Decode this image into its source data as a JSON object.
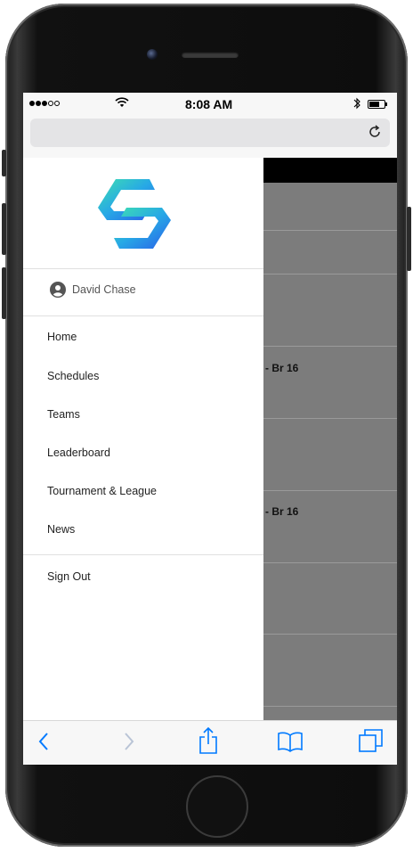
{
  "status_bar": {
    "time": "8:08 AM",
    "signal_bars": 3,
    "battery_level": 0.7
  },
  "url_bar": {
    "value": "",
    "reload_icon": "reload-icon"
  },
  "drawer": {
    "logo_icon": "hexagon-s-logo-icon",
    "user": {
      "icon": "user-circle-icon",
      "name": "David Chase"
    },
    "menu": [
      {
        "label": "Home"
      },
      {
        "label": "Schedules"
      },
      {
        "label": "Teams"
      },
      {
        "label": "Leaderboard"
      },
      {
        "label": "Tournament & League"
      },
      {
        "label": "News"
      }
    ],
    "sign_out": "Sign Out"
  },
  "background_page": {
    "rows": [
      {
        "text": ""
      },
      {
        "text": ""
      },
      {
        "text": "- Br 16"
      },
      {
        "text": ""
      },
      {
        "text": "- Br 16"
      },
      {
        "text": ""
      },
      {
        "text": ""
      }
    ]
  },
  "toolbar": {
    "icons": [
      "back-icon",
      "forward-icon",
      "share-icon",
      "bookmarks-icon",
      "tabs-icon"
    ]
  },
  "colors": {
    "accent": "#007aff",
    "logo_gradient_start": "#3ee0b0",
    "logo_gradient_end": "#2a5ee8"
  }
}
